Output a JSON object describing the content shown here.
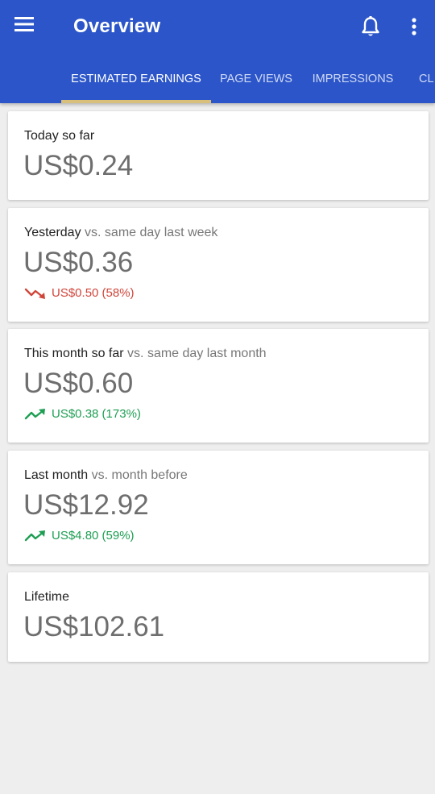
{
  "appbar": {
    "title": "Overview",
    "icons": {
      "menu": "menu-icon",
      "notifications": "bell-icon",
      "more": "more-vertical-icon"
    }
  },
  "tabs": [
    {
      "label": "ESTIMATED EARNINGS",
      "active": true
    },
    {
      "label": "PAGE VIEWS",
      "active": false
    },
    {
      "label": "IMPRESSIONS",
      "active": false
    },
    {
      "label": "CL",
      "active": false
    }
  ],
  "cards": [
    {
      "label": "Today so far",
      "comparison": "",
      "value": "US$0.24"
    },
    {
      "label": "Yesterday",
      "comparison": " vs. same day last week",
      "value": "US$0.36",
      "delta": {
        "direction": "down",
        "text": "US$0.50 (58%)"
      }
    },
    {
      "label": "This month so far",
      "comparison": " vs. same day last month",
      "value": "US$0.60",
      "delta": {
        "direction": "up",
        "text": "US$0.38 (173%)"
      }
    },
    {
      "label": "Last month",
      "comparison": " vs. month before",
      "value": "US$12.92",
      "delta": {
        "direction": "up",
        "text": "US$4.80 (59%)"
      }
    },
    {
      "label": "Lifetime",
      "comparison": "",
      "value": "US$102.61"
    }
  ],
  "colors": {
    "appbar": "#2b55c9",
    "tab_indicator": "#d8c07a",
    "negative": "#d0453a",
    "positive": "#1e9e53",
    "background": "#eeeeee"
  }
}
